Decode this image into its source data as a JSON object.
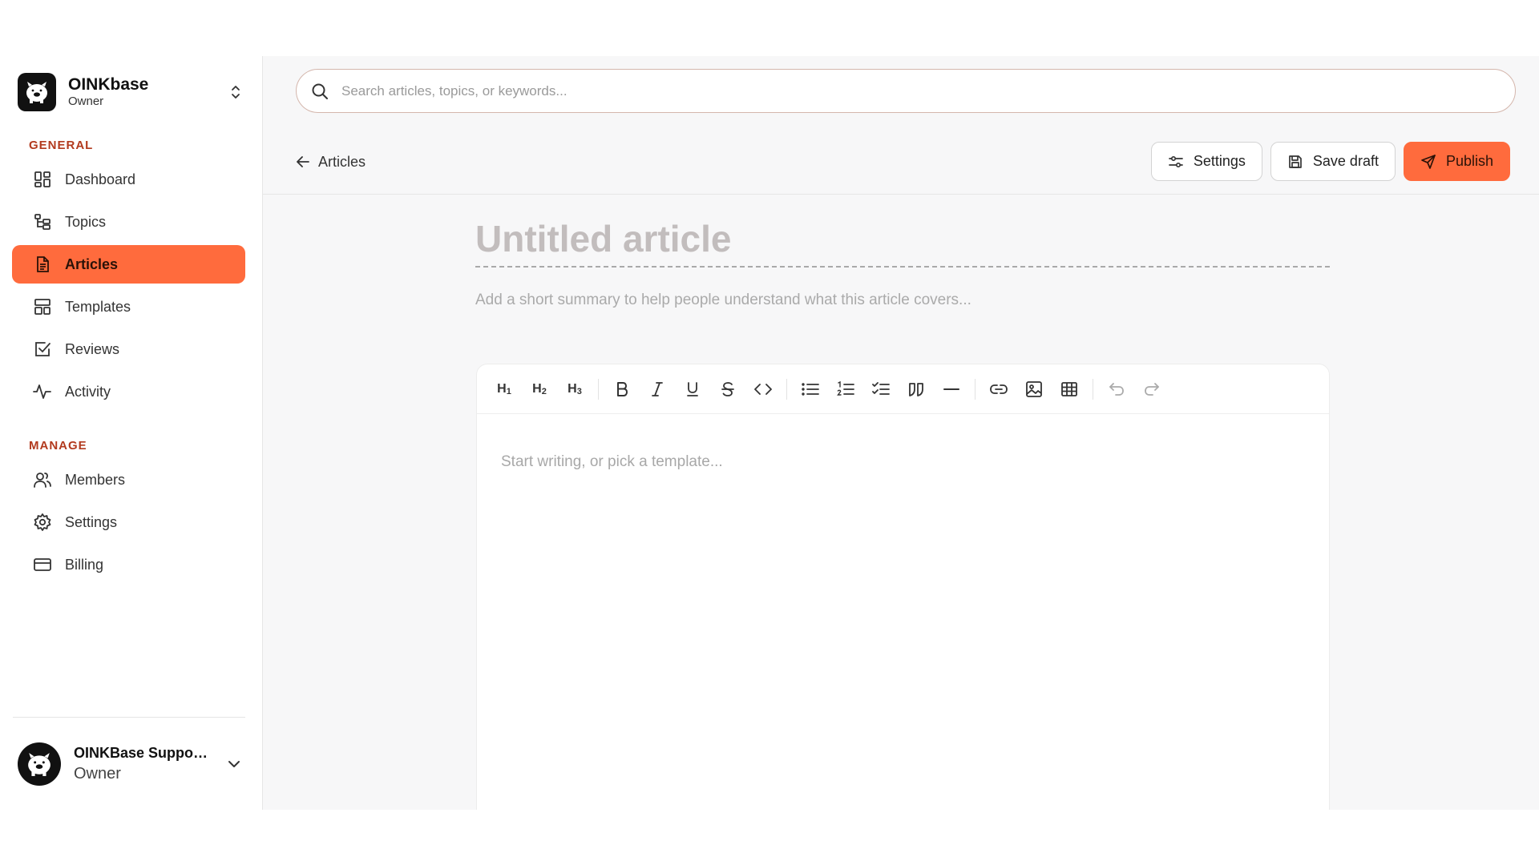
{
  "workspace": {
    "name": "OINKbase",
    "role": "Owner"
  },
  "sidebar": {
    "general_label": "GENERAL",
    "general_items": [
      {
        "label": "Dashboard",
        "icon": "dashboard-icon"
      },
      {
        "label": "Topics",
        "icon": "topics-icon"
      },
      {
        "label": "Articles",
        "icon": "articles-icon",
        "active": true
      },
      {
        "label": "Templates",
        "icon": "templates-icon"
      },
      {
        "label": "Reviews",
        "icon": "reviews-icon"
      },
      {
        "label": "Activity",
        "icon": "activity-icon"
      }
    ],
    "manage_label": "MANAGE",
    "manage_items": [
      {
        "label": "Members",
        "icon": "members-icon"
      },
      {
        "label": "Settings",
        "icon": "settings-icon"
      },
      {
        "label": "Billing",
        "icon": "billing-icon"
      }
    ]
  },
  "user": {
    "name": "OINKBase Suppor...",
    "role": "Owner"
  },
  "search": {
    "placeholder": "Search articles, topics, or keywords..."
  },
  "header": {
    "back_label": "Articles",
    "settings_label": "Settings",
    "save_label": "Save draft",
    "publish_label": "Publish"
  },
  "article": {
    "title_placeholder": "Untitled article",
    "summary_placeholder": "Add a short summary to help people understand what this article covers...",
    "body_placeholder": "Start writing, or pick a template..."
  },
  "toolbar": {
    "h1": "H",
    "h1_sub": "1",
    "h2": "H",
    "h2_sub": "2",
    "h3": "H",
    "h3_sub": "3"
  },
  "colors": {
    "accent": "#ff6b3d",
    "section_label": "#b23a1e",
    "main_bg": "#f7f7f8"
  }
}
